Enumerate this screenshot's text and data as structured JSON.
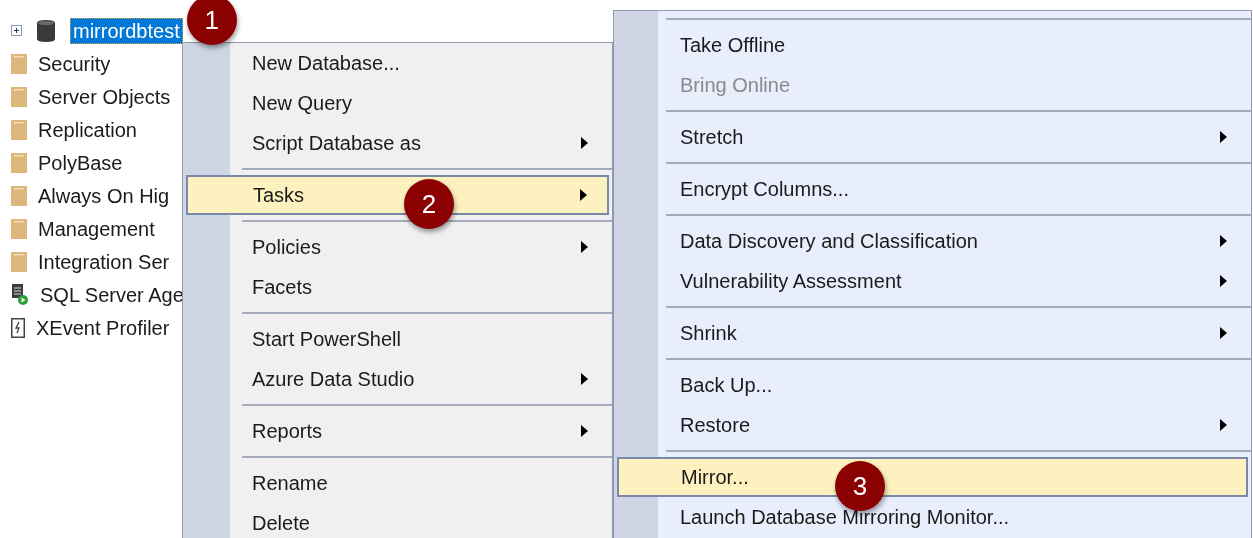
{
  "tree": {
    "items": [
      {
        "label": "mirrordbtest",
        "kind": "database",
        "selected": true,
        "expanded": false,
        "callout": "1"
      },
      {
        "label": "Security",
        "kind": "folder",
        "selected": false
      },
      {
        "label": "Server Objects",
        "kind": "folder",
        "selected": false
      },
      {
        "label": "Replication",
        "kind": "folder",
        "selected": false
      },
      {
        "label": "PolyBase",
        "kind": "folder",
        "selected": false
      },
      {
        "label": "Always On Hig",
        "kind": "folder",
        "selected": false
      },
      {
        "label": "Management",
        "kind": "folder",
        "selected": false
      },
      {
        "label": "Integration Ser",
        "kind": "folder",
        "selected": false
      },
      {
        "label": "SQL Server Age",
        "kind": "agent",
        "selected": false
      },
      {
        "label": "XEvent Profiler",
        "kind": "profiler",
        "selected": false
      }
    ]
  },
  "context_menu": {
    "groups": [
      [
        {
          "label": "New Database...",
          "submenu": false,
          "selected": false
        },
        {
          "label": "New Query",
          "submenu": false,
          "selected": false
        },
        {
          "label": "Script Database as",
          "submenu": true,
          "selected": false
        }
      ],
      [
        {
          "label": "Tasks",
          "submenu": true,
          "selected": true,
          "callout": "2"
        }
      ],
      [
        {
          "label": "Policies",
          "submenu": true,
          "selected": false
        },
        {
          "label": "Facets",
          "submenu": false,
          "selected": false
        }
      ],
      [
        {
          "label": "Start PowerShell",
          "submenu": false,
          "selected": false
        },
        {
          "label": "Azure Data Studio",
          "submenu": true,
          "selected": false
        }
      ],
      [
        {
          "label": "Reports",
          "submenu": true,
          "selected": false
        }
      ],
      [
        {
          "label": "Rename",
          "submenu": false,
          "selected": false
        },
        {
          "label": "Delete",
          "submenu": false,
          "selected": false
        }
      ]
    ]
  },
  "tasks_submenu": {
    "groups": [
      [
        {
          "label": "Take Offline",
          "submenu": false,
          "selected": false,
          "disabled": false
        },
        {
          "label": "Bring Online",
          "submenu": false,
          "selected": false,
          "disabled": true
        }
      ],
      [
        {
          "label": "Stretch",
          "submenu": true,
          "selected": false,
          "disabled": false
        }
      ],
      [
        {
          "label": "Encrypt Columns...",
          "submenu": false,
          "selected": false,
          "disabled": false
        }
      ],
      [
        {
          "label": "Data Discovery and Classification",
          "submenu": true,
          "selected": false,
          "disabled": false
        },
        {
          "label": "Vulnerability Assessment",
          "submenu": true,
          "selected": false,
          "disabled": false
        }
      ],
      [
        {
          "label": "Shrink",
          "submenu": true,
          "selected": false,
          "disabled": false
        }
      ],
      [
        {
          "label": "Back Up...",
          "submenu": false,
          "selected": false,
          "disabled": false
        },
        {
          "label": "Restore",
          "submenu": true,
          "selected": false,
          "disabled": false
        }
      ],
      [
        {
          "label": "Mirror...",
          "submenu": false,
          "selected": true,
          "disabled": false,
          "callout": "3"
        },
        {
          "label": "Launch Database Mirroring Monitor...",
          "submenu": false,
          "selected": false,
          "disabled": false
        }
      ]
    ]
  }
}
